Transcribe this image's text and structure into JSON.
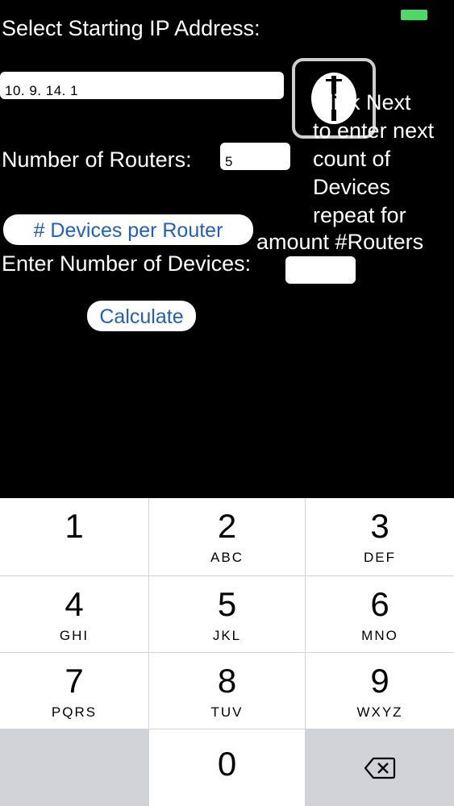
{
  "status": {
    "battery_color": "#4cd964"
  },
  "form": {
    "ip_label": "Select Starting IP Address:",
    "ip_value": "10. 9. 14. 1",
    "routers_label": "Number of Routers:",
    "routers_value": "5",
    "devices_per_router_button": "# Devices per Router",
    "devices_label": "Enter Number of Devices:",
    "devices_value": "",
    "calculate_button": "Calculate"
  },
  "next": {
    "icon": "next-icon",
    "hint_lines": [
      "Click Next",
      "to enter next",
      "count of",
      "Devices",
      "repeat for",
      "amount #Routers"
    ]
  },
  "keypad": {
    "keys": [
      {
        "num": "1",
        "letters": ""
      },
      {
        "num": "2",
        "letters": "ABC"
      },
      {
        "num": "3",
        "letters": "DEF"
      },
      {
        "num": "4",
        "letters": "GHI"
      },
      {
        "num": "5",
        "letters": "JKL"
      },
      {
        "num": "6",
        "letters": "MNO"
      },
      {
        "num": "7",
        "letters": "PQRS"
      },
      {
        "num": "8",
        "letters": "TUV"
      },
      {
        "num": "9",
        "letters": "WXYZ"
      },
      {
        "num": "0",
        "letters": ""
      }
    ],
    "delete_icon": "backspace-icon",
    "accent": "#1f5fc4"
  }
}
